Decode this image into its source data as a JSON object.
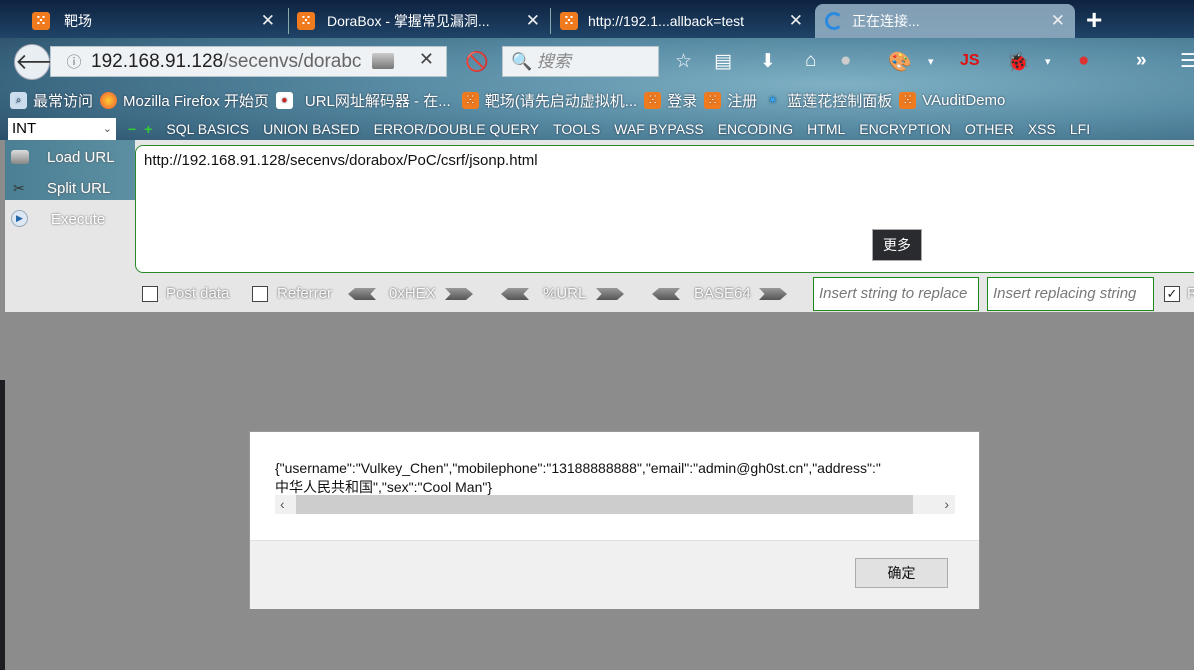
{
  "tabs": [
    {
      "title": "靶场",
      "active": false
    },
    {
      "title": "DoraBox - 掌握常见漏洞...",
      "active": false
    },
    {
      "title": "http://192.1...allback=test",
      "active": false
    },
    {
      "title": "正在连接...",
      "active": true,
      "loading": true
    }
  ],
  "nav": {
    "url_host": "192.168.91.128",
    "url_path": "/secenvs/dorabc",
    "search_placeholder": "搜索",
    "js_label": "JS"
  },
  "bookmarks": [
    {
      "label": "最常访问",
      "icon": "search-icon"
    },
    {
      "label": "Mozilla Firefox 开始页",
      "icon": "firefox-icon"
    },
    {
      "label": "URL网址解码器 - 在...",
      "icon": "site-icon"
    },
    {
      "label": "靶场(请先启动虚拟机...",
      "icon": "xampp-icon"
    },
    {
      "label": "登录",
      "icon": "xampp-icon"
    },
    {
      "label": "注册",
      "icon": "xampp-icon"
    },
    {
      "label": "蓝莲花控制面板",
      "icon": "lotus-icon"
    },
    {
      "label": "VAuditDemo",
      "icon": "xampp-icon"
    }
  ],
  "hackbar": {
    "type_select": "INT",
    "menus": [
      "SQL BASICS",
      "UNION BASED",
      "ERROR/DOUBLE QUERY",
      "TOOLS",
      "WAF BYPASS",
      "ENCODING",
      "HTML",
      "ENCRYPTION",
      "OTHER",
      "XSS",
      "LFI"
    ],
    "load_url": "Load URL",
    "split_url": "Split URL",
    "execute": "Execute",
    "url_value": "http://192.168.91.128/secenvs/dorabox/PoC/csrf/jsonp.html",
    "more_tooltip": "更多",
    "post_data": "Post data",
    "referrer": "Referrer",
    "hex": "0xHEX",
    "urlenc": "%URL",
    "base64": "BASE64",
    "replace_placeholder": "Insert string to replace",
    "replacing_placeholder": "Insert replacing string",
    "replace_all_checked": true,
    "replace_all_label": "R"
  },
  "dialog": {
    "line1": "{\"username\":\"Vulkey_Chen\",\"mobilephone\":\"13188888888\",\"email\":\"admin@gh0st.cn\",\"address\":\"",
    "line2": "中华人民共和国\",\"sex\":\"Cool Man\"}",
    "ok": "确定"
  }
}
